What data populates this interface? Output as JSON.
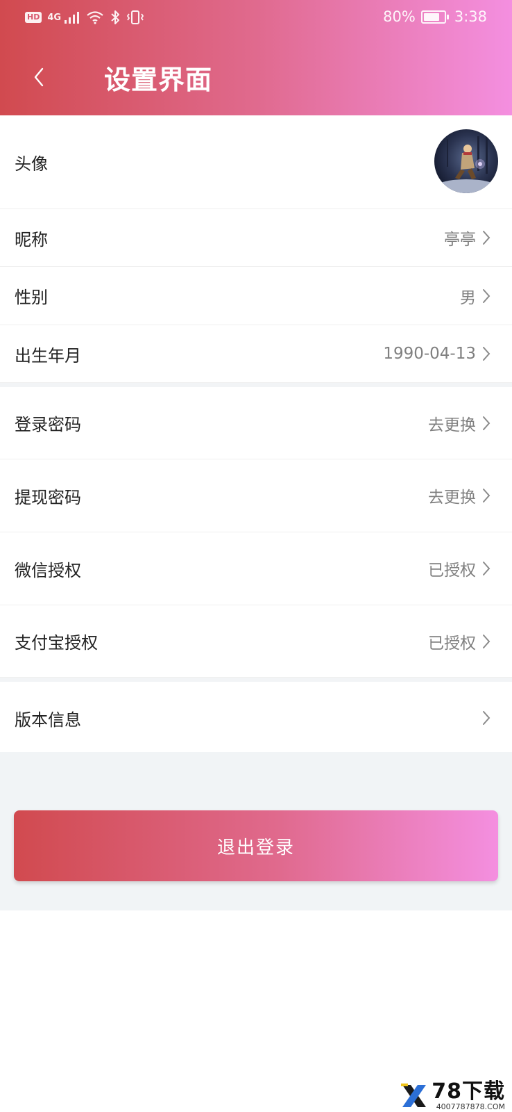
{
  "status_bar": {
    "hd": "HD",
    "network": "4G",
    "battery_text": "80%",
    "battery_level": 0.8,
    "time": "3:38"
  },
  "header": {
    "title": "设置界面",
    "gradient": [
      "#d14a4f",
      "#f48fe0"
    ]
  },
  "settings": {
    "avatar": {
      "label": "头像"
    },
    "nickname": {
      "label": "昵称",
      "value": "亭亭"
    },
    "gender": {
      "label": "性别",
      "value": "男"
    },
    "birth": {
      "label": "出生年月",
      "value": "1990-04-13"
    },
    "login_password": {
      "label": "登录密码",
      "value": "去更换"
    },
    "withdraw_password": {
      "label": "提现密码",
      "value": "去更换"
    },
    "wechat_auth": {
      "label": "微信授权",
      "value": "已授权"
    },
    "alipay_auth": {
      "label": "支付宝授权",
      "value": "已授权"
    },
    "version": {
      "label": "版本信息"
    }
  },
  "logout_button": {
    "label": "退出登录"
  },
  "watermark": {
    "brand": "78下载",
    "url": "4007787878.COM"
  },
  "colors": {
    "accent_start": "#d14a4f",
    "accent_end": "#f48fe0",
    "label_text": "#222222",
    "value_text": "#808080",
    "section_bg": "#f1f4f6"
  },
  "icons": [
    "back-arrow-icon",
    "chevron-right-icon",
    "signal-icon",
    "wifi-icon",
    "bluetooth-icon",
    "vibrate-icon",
    "battery-icon"
  ]
}
